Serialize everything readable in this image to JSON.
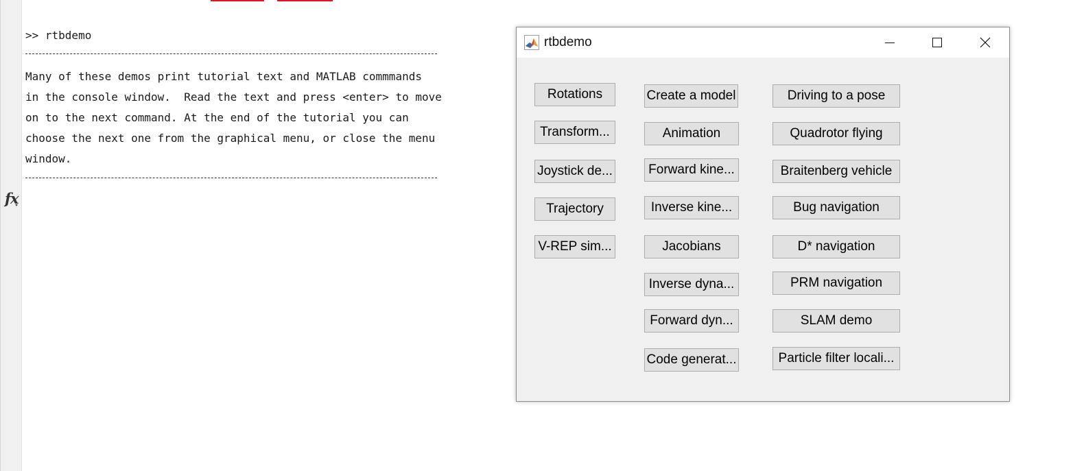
{
  "console": {
    "prompt": ">> rtbdemo",
    "tutorial_lines": [
      "Many of these demos print tutorial text and MATLAB commmands",
      "in the console window.  Read the text and press <enter> to move",
      "on to the next command. At the end of the tutorial you can",
      "choose the next one from the graphical menu, or close the menu",
      "window."
    ],
    "accent_color": "#e0161b"
  },
  "icons": {
    "function_browser": "fx-icon",
    "app": "matlab-logo-icon",
    "minimize": "minimize-icon",
    "maximize": "maximize-icon",
    "close": "close-icon"
  },
  "demo_window": {
    "title": "rtbdemo",
    "columns": [
      [
        "Rotations",
        "Transform...",
        "Joystick de...",
        "Trajectory",
        "V-REP sim..."
      ],
      [
        "Create a model",
        "Animation",
        "Forward kine...",
        "Inverse kine...",
        "Jacobians",
        "Inverse dyna...",
        "Forward dyn...",
        "Code generat..."
      ],
      [
        "Driving to a pose",
        "Quadrotor flying",
        "Braitenberg vehicle",
        "Bug navigation",
        "D* navigation",
        "PRM navigation",
        "SLAM demo",
        "Particle filter locali..."
      ]
    ]
  }
}
